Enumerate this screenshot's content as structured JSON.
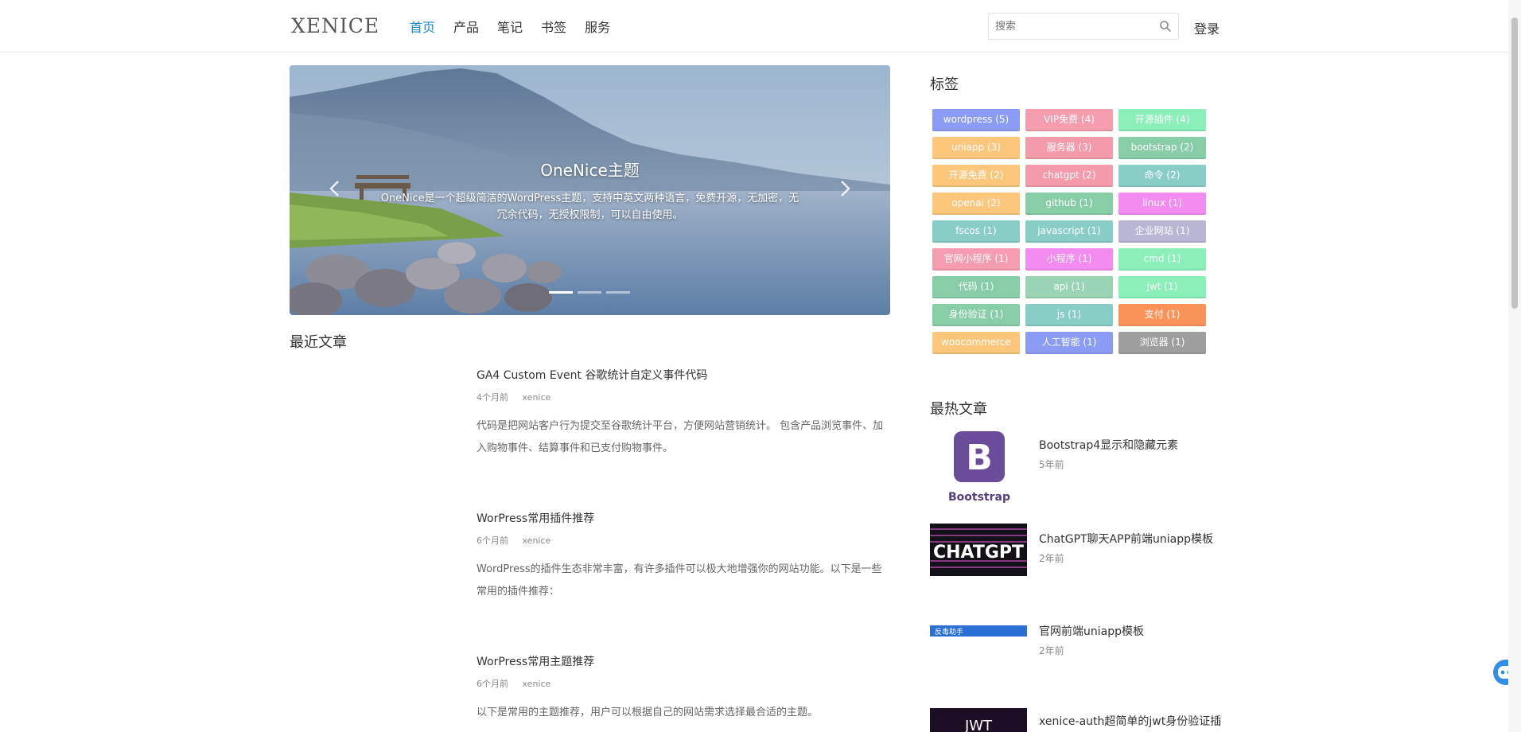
{
  "header": {
    "logo": "XENICE",
    "nav": [
      {
        "label": "首页",
        "active": true
      },
      {
        "label": "产品",
        "active": false
      },
      {
        "label": "笔记",
        "active": false
      },
      {
        "label": "书签",
        "active": false
      },
      {
        "label": "服务",
        "active": false
      }
    ],
    "search_placeholder": "搜索",
    "login": "登录"
  },
  "carousel": {
    "title": "OneNice主题",
    "description": "OneNice是一个超级简洁的WordPress主题，支持中英文两种语言，免费开源，无加密，无冗余代码，无授权限制，可以自由使用。"
  },
  "recent": {
    "heading": "最近文章",
    "posts": [
      {
        "title": "GA4 Custom Event 谷歌统计自定义事件代码",
        "time": "4个月前",
        "author": "xenice",
        "excerpt": "代码是把网站客户行为提交至谷歌统计平台，方便网站营销统计。 包含产品浏览事件、加入购物事件、结算事件和已支付购物事件。"
      },
      {
        "title": "WorPress常用插件推荐",
        "time": "6个月前",
        "author": "xenice",
        "excerpt": "WordPress的插件生态非常丰富，有许多插件可以极大地增强你的网站功能。以下是一些常用的插件推荐："
      },
      {
        "title": "WorPress常用主题推荐",
        "time": "6个月前",
        "author": "xenice",
        "excerpt": "以下是常用的主题推荐，用户可以根据自己的网站需求选择最合适的主题。"
      }
    ]
  },
  "tags": {
    "heading": "标签",
    "items": [
      {
        "label": "wordpress (5)",
        "color": "#8b9cf7"
      },
      {
        "label": "VIP免费 (4)",
        "color": "#f69caf"
      },
      {
        "label": "开源插件 (4)",
        "color": "#8af0b7"
      },
      {
        "label": "uniapp (3)",
        "color": "#fcc77b"
      },
      {
        "label": "服务器 (3)",
        "color": "#f59aaa"
      },
      {
        "label": "bootstrap (2)",
        "color": "#86cda8"
      },
      {
        "label": "开源免费 (2)",
        "color": "#fcc77b"
      },
      {
        "label": "chatgpt (2)",
        "color": "#f59aaa"
      },
      {
        "label": "命令 (2)",
        "color": "#89cdc7"
      },
      {
        "label": "openai (2)",
        "color": "#fcc77b"
      },
      {
        "label": "github (1)",
        "color": "#86cda8"
      },
      {
        "label": "linux (1)",
        "color": "#f38bf1"
      },
      {
        "label": "fscos (1)",
        "color": "#89cdc7"
      },
      {
        "label": "javascript (1)",
        "color": "#89cdc7"
      },
      {
        "label": "企业网站 (1)",
        "color": "#b9b5d4"
      },
      {
        "label": "官网小程序 (1)",
        "color": "#f69caf"
      },
      {
        "label": "小程序 (1)",
        "color": "#f38bf1"
      },
      {
        "label": "cmd (1)",
        "color": "#8af0b7"
      },
      {
        "label": "代码 (1)",
        "color": "#86cda8"
      },
      {
        "label": "api (1)",
        "color": "#99d4b4"
      },
      {
        "label": "jwt (1)",
        "color": "#8af0b7"
      },
      {
        "label": "身份验证 (1)",
        "color": "#86cda8"
      },
      {
        "label": "js (1)",
        "color": "#89cdc7"
      },
      {
        "label": "支付 (1)",
        "color": "#fb9358"
      },
      {
        "label": "woocommerce",
        "color": "#fcc77b"
      },
      {
        "label": "人工智能 (1)",
        "color": "#8b9cf7"
      },
      {
        "label": "浏览器 (1)",
        "color": "#9e9e9e"
      }
    ]
  },
  "hot": {
    "heading": "最热文章",
    "posts": [
      {
        "title": "Bootstrap4显示和隐藏元素",
        "time": "5年前",
        "thumb": "bootstrap-logo",
        "thumb_text": "Bootstrap"
      },
      {
        "title": "ChatGPT聊天APP前端uniapp模板",
        "time": "2年前",
        "thumb": "chatgpt-banner",
        "thumb_text": "CHATGPT"
      },
      {
        "title": "官网前端uniapp模板",
        "time": "2年前",
        "thumb": "uniapp-banner",
        "thumb_text": "反毒助手"
      },
      {
        "title": "xenice-auth超简单的jwt身份验证插",
        "time": "",
        "thumb": "jwt-banner",
        "thumb_text": "JWT"
      }
    ]
  }
}
